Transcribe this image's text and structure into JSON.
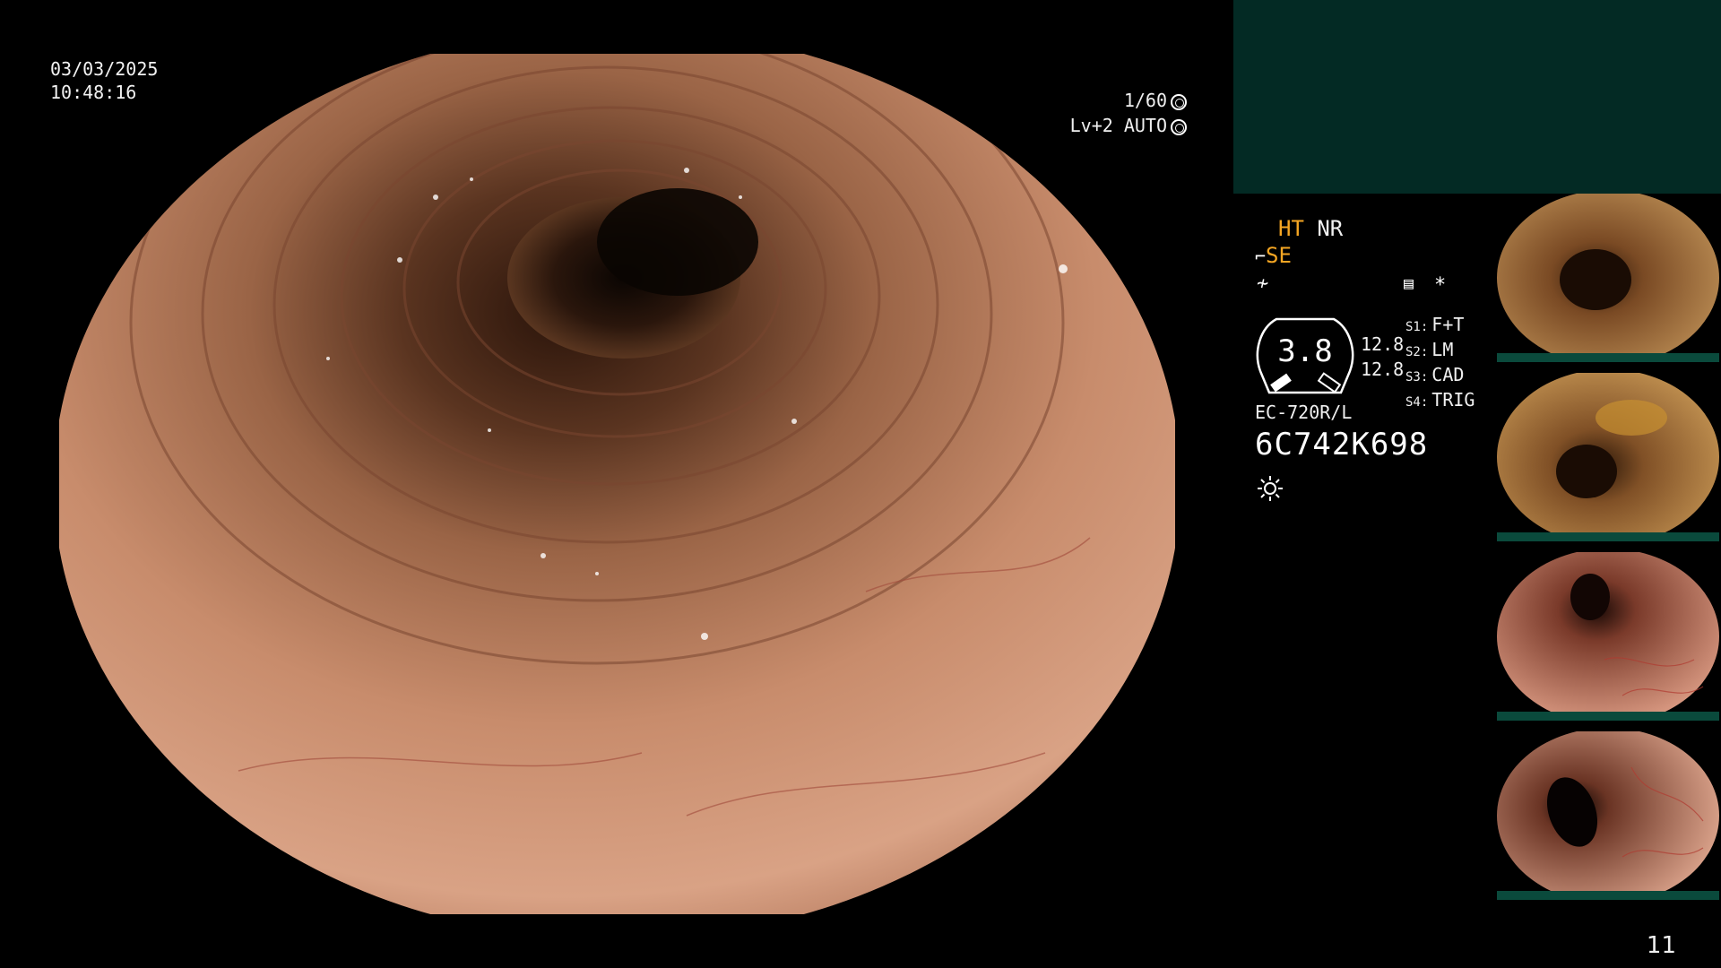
{
  "header": {
    "date": "03/03/2025",
    "time": "10:48:16"
  },
  "exposure": {
    "shutter": "1/60",
    "level": "Lv+2 AUTO"
  },
  "status": {
    "ht": "HT",
    "nr": "NR",
    "se": "SE"
  },
  "gauge": {
    "value": "3.8",
    "upper": "12.8",
    "lower": "12.8"
  },
  "settings": [
    {
      "key": "S1:",
      "value": "F+T"
    },
    {
      "key": "S2:",
      "value": "LM"
    },
    {
      "key": "S3:",
      "value": "CAD"
    },
    {
      "key": "S4:",
      "value": "TRIG"
    }
  ],
  "scope": {
    "model": "EC-720R/L",
    "serial": "6C742K698"
  },
  "thumbnails": [
    {
      "name": "capture-1",
      "tint": "#a8703a"
    },
    {
      "name": "capture-2",
      "tint": "#b0783a"
    },
    {
      "name": "capture-3",
      "tint": "#c88a6a"
    },
    {
      "name": "capture-4",
      "tint": "#c98e72"
    }
  ],
  "page": {
    "number": "11"
  },
  "colors": {
    "accent_orange": "#f5a623",
    "panel_teal": "#032a24"
  }
}
